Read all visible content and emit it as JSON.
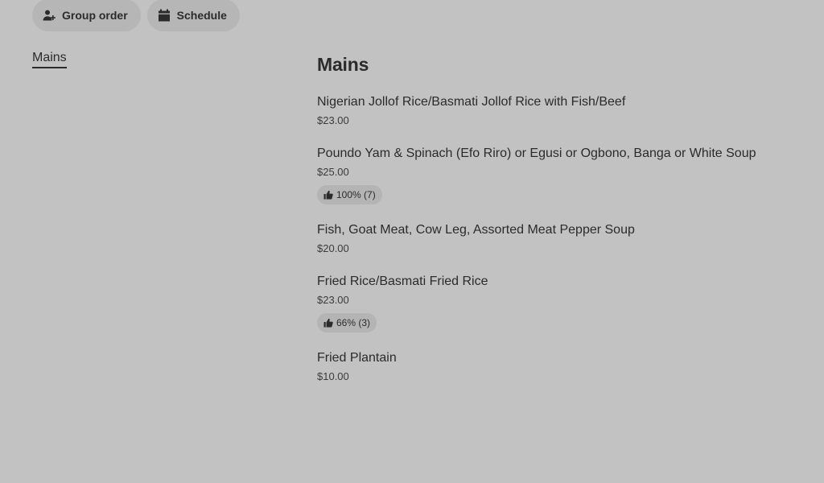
{
  "actions": {
    "group_order": {
      "label": "Group order",
      "icon": "add-person-icon"
    },
    "schedule": {
      "label": "Schedule",
      "icon": "calendar-icon"
    }
  },
  "sidebar": {
    "items": [
      {
        "label": "Mains",
        "active": true
      }
    ]
  },
  "section": {
    "title": "Mains",
    "items": [
      {
        "name": "Nigerian Jollof Rice/Basmati Jollof Rice with Fish/Beef",
        "price": "$23.00"
      },
      {
        "name": "Poundo Yam & Spinach (Efo Riro) or Egusi or Ogbono, Banga or White Soup",
        "price": "$25.00",
        "rating": "100% (7)"
      },
      {
        "name": "Fish, Goat Meat, Cow Leg, Assorted Meat Pepper Soup",
        "price": "$20.00"
      },
      {
        "name": "Fried Rice/Basmati Fried Rice",
        "price": "$23.00",
        "rating": "66% (3)"
      },
      {
        "name": "Fried Plantain",
        "price": "$10.00"
      }
    ]
  },
  "colors": {
    "background": "#c2c2c2",
    "pill": "#b6b6b6",
    "text": "#2b2b2b"
  }
}
